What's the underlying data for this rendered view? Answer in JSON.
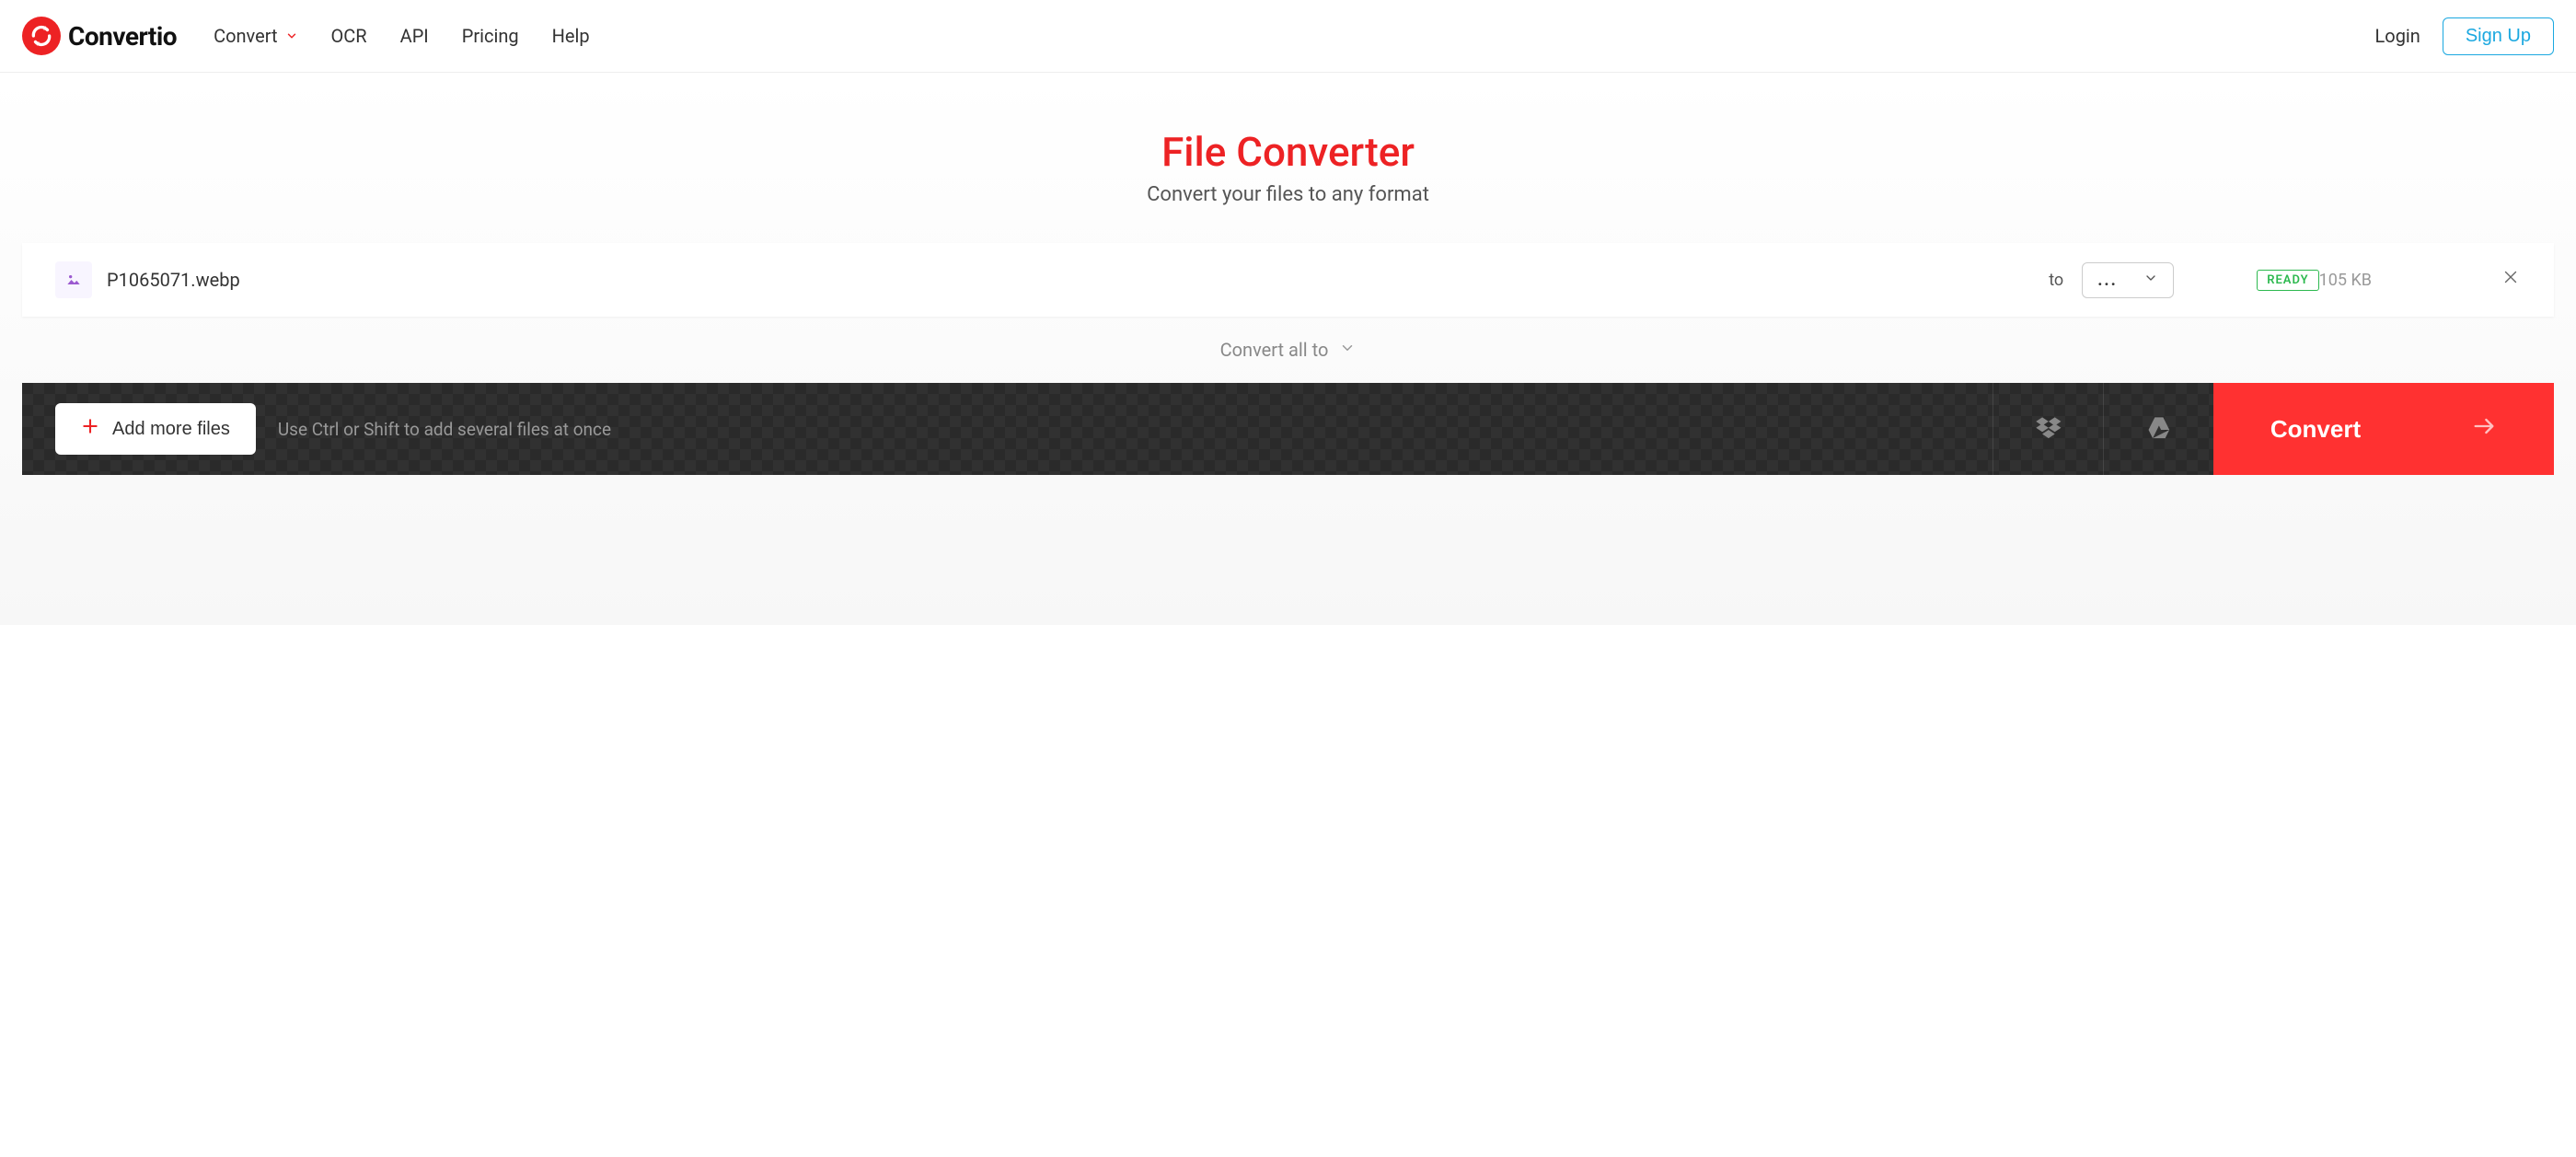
{
  "brand": {
    "name": "Convertio"
  },
  "nav": {
    "convert": "Convert",
    "ocr": "OCR",
    "api": "API",
    "pricing": "Pricing",
    "help": "Help"
  },
  "auth": {
    "login": "Login",
    "signup": "Sign Up"
  },
  "hero": {
    "title": "File Converter",
    "subtitle": "Convert your files to any format"
  },
  "file": {
    "name": "P1065071.webp",
    "to_label": "to",
    "format_placeholder": "...",
    "status": "READY",
    "size": "105 KB"
  },
  "convert_all": {
    "label": "Convert all to"
  },
  "actions": {
    "add_more": "Add more files",
    "hint": "Use Ctrl or Shift to add several files at once",
    "convert": "Convert"
  }
}
